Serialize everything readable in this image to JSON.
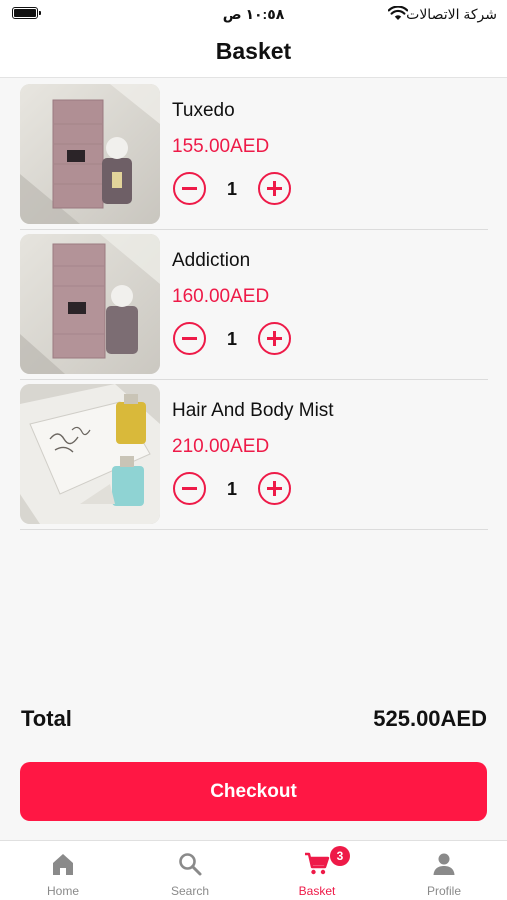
{
  "status_bar": {
    "time": "١٠:٥٨ ص",
    "carrier": "شركة الاتصالات"
  },
  "header": {
    "title": "Basket"
  },
  "cart": {
    "items": [
      {
        "name": "Tuxedo",
        "price": "155.00AED",
        "quantity": "1"
      },
      {
        "name": "Addiction",
        "price": "160.00AED",
        "quantity": "1"
      },
      {
        "name": "Hair And Body Mist",
        "price": "210.00AED",
        "quantity": "1"
      }
    ]
  },
  "summary": {
    "total_label": "Total",
    "total_value": "525.00AED"
  },
  "checkout": {
    "label": "Checkout"
  },
  "tab_bar": {
    "tabs": [
      {
        "label": "Home",
        "icon": "home-icon"
      },
      {
        "label": "Search",
        "icon": "search-icon"
      },
      {
        "label": "Basket",
        "icon": "cart-icon",
        "badge": "3",
        "active": true
      },
      {
        "label": "Profile",
        "icon": "profile-icon"
      }
    ]
  },
  "colors": {
    "accent": "#ee1a48",
    "checkout_button": "#ff1744",
    "inactive_tab": "#8a8a8a"
  }
}
